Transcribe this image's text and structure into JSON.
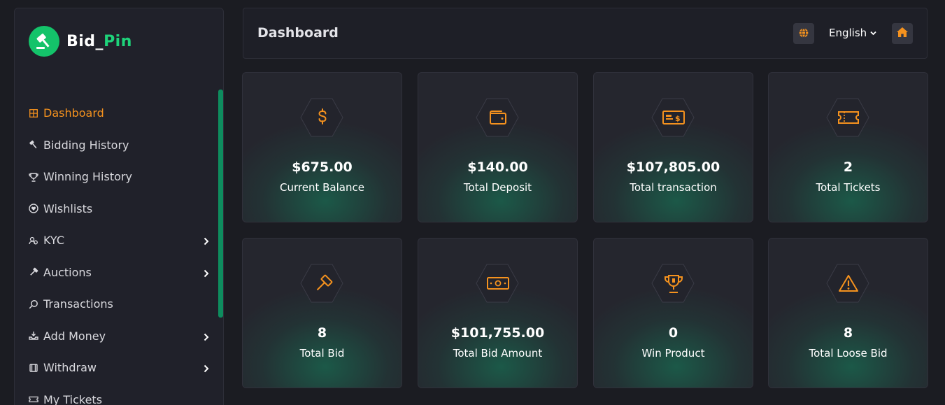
{
  "brand": {
    "name_part1": "Bid_",
    "name_part2": "Pin"
  },
  "sidebar": {
    "items": [
      {
        "label": "Dashboard",
        "icon": "grid-icon",
        "active": true
      },
      {
        "label": "Bidding History",
        "icon": "gavel-icon"
      },
      {
        "label": "Winning History",
        "icon": "trophy-icon"
      },
      {
        "label": "Wishlists",
        "icon": "heart-icon"
      },
      {
        "label": "KYC",
        "icon": "users-icon",
        "has_submenu": true
      },
      {
        "label": "Auctions",
        "icon": "hammer-icon",
        "has_submenu": true
      },
      {
        "label": "Transactions",
        "icon": "search-icon"
      },
      {
        "label": "Add Money",
        "icon": "deposit-icon",
        "has_submenu": true
      },
      {
        "label": "Withdraw",
        "icon": "withdraw-icon",
        "has_submenu": true
      },
      {
        "label": "My Tickets",
        "icon": "ticket-icon"
      }
    ]
  },
  "header": {
    "title": "Dashboard",
    "language": "English"
  },
  "colors": {
    "accent": "#f5921e",
    "brand": "#14c36a",
    "bg": "#1b1c22",
    "card": "#25262e"
  },
  "cards": [
    {
      "value": "$675.00",
      "label": "Current Balance",
      "icon": "dollar-icon"
    },
    {
      "value": "$140.00",
      "label": "Total Deposit",
      "icon": "wallet-icon"
    },
    {
      "value": "$107,805.00",
      "label": "Total transaction",
      "icon": "money-bill-icon"
    },
    {
      "value": "2",
      "label": "Total Tickets",
      "icon": "ticket-icon"
    },
    {
      "value": "8",
      "label": "Total Bid",
      "icon": "gavel-icon"
    },
    {
      "value": "$101,755.00",
      "label": "Total Bid Amount",
      "icon": "banknote-icon"
    },
    {
      "value": "0",
      "label": "Win Product",
      "icon": "trophy-icon"
    },
    {
      "value": "8",
      "label": "Total Loose Bid",
      "icon": "warning-icon"
    }
  ]
}
